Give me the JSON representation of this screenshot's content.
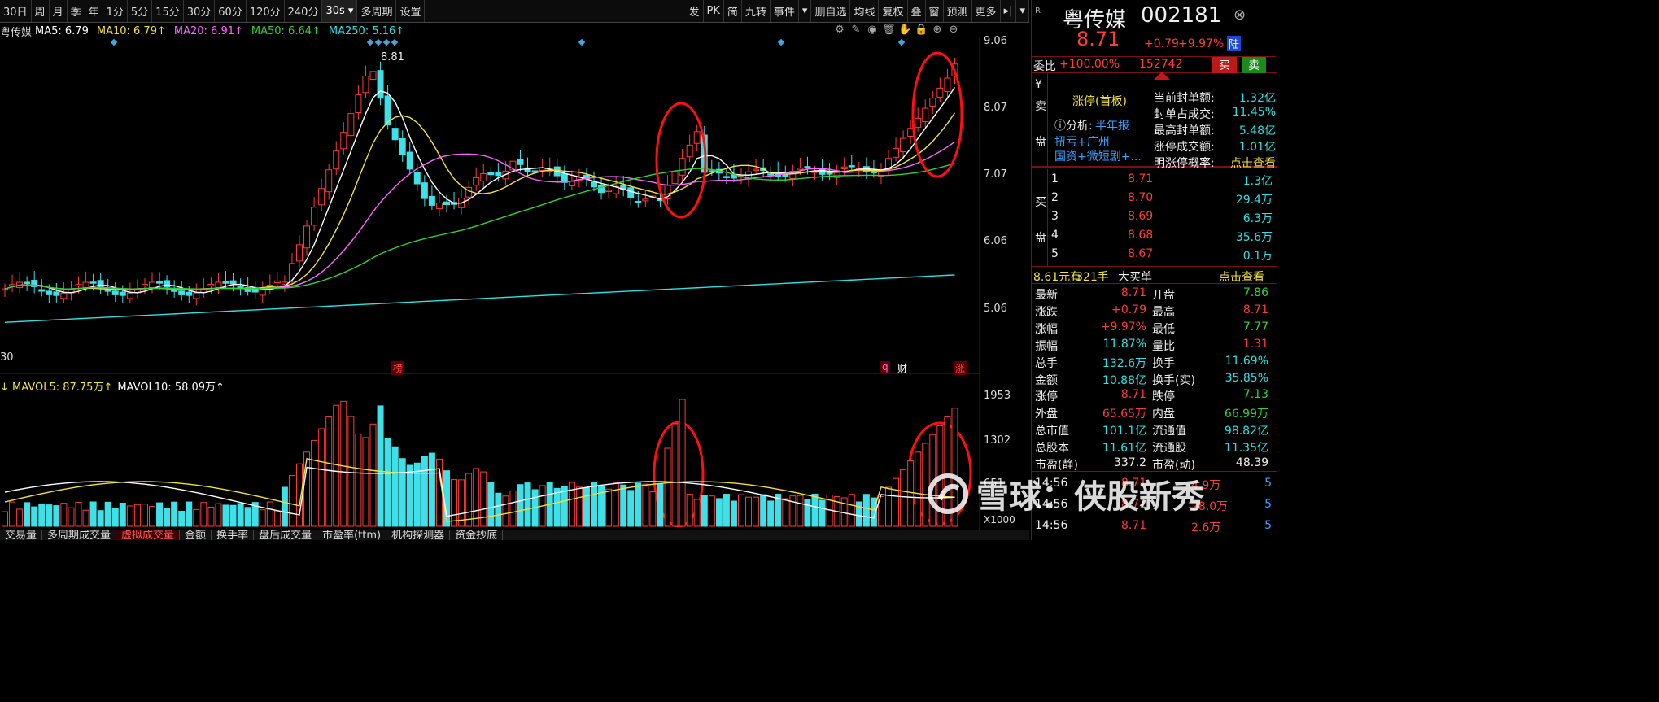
{
  "toolbar": {
    "periods": [
      "30日",
      "周",
      "月",
      "季",
      "年",
      "1分",
      "5分",
      "15分",
      "30分",
      "60分",
      "120分",
      "240分",
      "30s"
    ],
    "periods_selected": "30s",
    "periods_extra": [
      "多周期",
      "设置"
    ],
    "right_tools": [
      "发",
      "PK",
      "简",
      "九转",
      "事件",
      "▾",
      "删自选",
      "均线",
      "复权",
      "叠",
      "窗",
      "预测",
      "更多",
      "▸|",
      "▾"
    ]
  },
  "ma_legend": {
    "stock": "粤传媒",
    "items": [
      {
        "label": "MA5: 6.79",
        "color": "#ffffff"
      },
      {
        "label": "MA10: 6.79↑",
        "color": "#f0e040"
      },
      {
        "label": "MA20: 6.91↑",
        "color": "#ff66ff"
      },
      {
        "label": "MA50: 6.64↑",
        "color": "#35d035"
      },
      {
        "label": "MA250: 5.16↑",
        "color": "#2ee0e0"
      }
    ]
  },
  "tool_icons": [
    "gear-icon",
    "pen-icon",
    "eye-icon",
    "trash-icon",
    "hand-icon",
    "lock-icon",
    "zoom-in-icon",
    "zoom-out-icon"
  ],
  "price_axis": [
    "9.06",
    "8.07",
    "7.07",
    "6.06",
    "5.06"
  ],
  "peak_label": "8.81",
  "left_edge_label": "30",
  "x_markers": [
    {
      "text": "榜",
      "color": "#ff4444"
    },
    {
      "text": "q",
      "color": "#ff66ff"
    },
    {
      "text": "财",
      "color": "#ffffff"
    },
    {
      "text": "涨",
      "color": "#ff4444"
    }
  ],
  "volume_legend": [
    {
      "label": "↓ MAVOL5: 87.75万↑",
      "color": "#f0e040"
    },
    {
      "label": "MAVOL10: 58.09万↑",
      "color": "#ffffff"
    }
  ],
  "volume_axis": [
    "1953",
    "1302",
    "651"
  ],
  "volume_unit": "X1000",
  "bottom_tabs": [
    "交易量",
    "多周期成交量",
    "虚拟成交量",
    "金额",
    "换手率",
    "盘后成交量",
    "市盈率(ttm)",
    "机构探测器",
    "资金抄底"
  ],
  "bottom_tab_active": "虚拟成交量",
  "stock": {
    "name": "粤传媒",
    "code": "002181",
    "price": "8.71",
    "change": "+0.79",
    "change_pct": "+9.97%",
    "exchange_tag": "陆",
    "weibi_label": "委比",
    "weibi": "+100.00%",
    "weicha": "152742",
    "buy_btn": "买",
    "sell_btn": "卖"
  },
  "limit_panel": {
    "side_label": [
      "¥",
      "卖",
      "盘"
    ],
    "title": "涨停(首板)",
    "analysis_label": "分析:",
    "analysis_link": "半年报",
    "concepts": "扭亏+广州",
    "concepts2": "国资+微短剧+...",
    "stats": [
      {
        "k": "当前封单额:",
        "v": "1.32亿"
      },
      {
        "k": "封单占成交:",
        "v": "11.45%"
      },
      {
        "k": "最高封单额:",
        "v": "5.48亿"
      },
      {
        "k": "涨停成交额:",
        "v": "1.01亿"
      },
      {
        "k": "明涨停概率:",
        "v": "点击查看"
      }
    ]
  },
  "buy_book": {
    "side_label": [
      "买",
      "盘"
    ],
    "rows": [
      {
        "lvl": "1",
        "price": "8.71",
        "vol": "1.3亿"
      },
      {
        "lvl": "2",
        "price": "8.70",
        "vol": "29.4万"
      },
      {
        "lvl": "3",
        "price": "8.69",
        "vol": "6.3万"
      },
      {
        "lvl": "4",
        "price": "8.68",
        "vol": "35.6万"
      },
      {
        "lvl": "5",
        "price": "8.67",
        "vol": "0.1万"
      }
    ]
  },
  "big_order": {
    "price": "8.61元有",
    "qty": "321手",
    "label": "大买单",
    "link": "点击查看"
  },
  "quote_stats": [
    {
      "k": "最新",
      "v": "8.71",
      "c": "rd",
      "k2": "开盘",
      "v2": "7.86",
      "c2": "gr"
    },
    {
      "k": "涨跌",
      "v": "+0.79",
      "c": "rd",
      "k2": "最高",
      "v2": "8.71",
      "c2": "rd"
    },
    {
      "k": "涨幅",
      "v": "+9.97%",
      "c": "rd",
      "k2": "最低",
      "v2": "7.77",
      "c2": "gr"
    },
    {
      "k": "振幅",
      "v": "11.87%",
      "c": "cy",
      "k2": "量比",
      "v2": "1.31",
      "c2": "rd"
    },
    {
      "k": "总手",
      "v": "132.6万",
      "c": "cy",
      "k2": "换手",
      "v2": "11.69%",
      "c2": "cy"
    },
    {
      "k": "金额",
      "v": "10.88亿",
      "c": "cy",
      "k2": "换手(实)",
      "v2": "35.85%",
      "c2": "cy"
    },
    {
      "k": "涨停",
      "v": "8.71",
      "c": "rd",
      "k2": "跌停",
      "v2": "7.13",
      "c2": "gr"
    },
    {
      "k": "外盘",
      "v": "65.65万",
      "c": "rd",
      "k2": "内盘",
      "v2": "66.99万",
      "c2": "gr"
    },
    {
      "k": "总市值",
      "v": "101.1亿",
      "c": "cy",
      "k2": "流通值",
      "v2": "98.82亿",
      "c2": "cy"
    },
    {
      "k": "总股本",
      "v": "11.61亿",
      "c": "cy",
      "k2": "流通股",
      "v2": "11.35亿",
      "c2": "cy"
    },
    {
      "k": "市盈(静)",
      "v": "337.2",
      "c": "wh",
      "k2": "市盈(动)",
      "v2": "48.39",
      "c2": "wh"
    }
  ],
  "ticks": [
    {
      "t": "14:56",
      "p": "8.71",
      "v": "4.9万",
      "n": "5"
    },
    {
      "t": "14:56",
      "p": "8.71",
      "v": "28.0万",
      "n": "5"
    },
    {
      "t": "14:56",
      "p": "8.71",
      "v": "2.6万",
      "n": "5"
    }
  ],
  "watermark": "雪球：侠股新秀"
}
